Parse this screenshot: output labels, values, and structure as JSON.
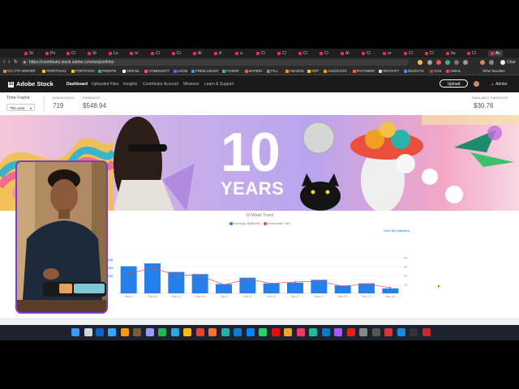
{
  "browser": {
    "tabs": [
      "St",
      "Po",
      "Cl",
      "St",
      "Lo",
      "ni",
      "Cl",
      "Cl",
      "Al",
      "A",
      "a",
      "Cl",
      "Cl",
      "Cl",
      "Cl",
      "Al",
      "Cl",
      "ur",
      "Cl",
      "Cl",
      "bu",
      "Cl",
      "Ac"
    ],
    "url": "https://contributor.stock.adobe.com/ws/portfolio",
    "profile_label": "Chat"
  },
  "bookmarks": [
    {
      "label": "ICC FTP SERVER",
      "color": "#e85"
    },
    {
      "label": "PORTFOLIO",
      "color": "#fc0"
    },
    {
      "label": "PORTFOOO",
      "color": "#fc0"
    },
    {
      "label": "FREEPIK",
      "color": "#4a8"
    },
    {
      "label": "VERCEL",
      "color": "#fff"
    },
    {
      "label": "COMMUNITY",
      "color": "#f55"
    },
    {
      "label": "LOOM",
      "color": "#66f"
    },
    {
      "label": "FREELANCER",
      "color": "#39f"
    },
    {
      "label": "FIVERR",
      "color": "#3c6"
    },
    {
      "label": "MAPBIN",
      "color": "#e55"
    },
    {
      "label": "FILL",
      "color": "#888"
    },
    {
      "label": "AMAZON",
      "color": "#f90"
    },
    {
      "label": "KDP",
      "color": "#fc0"
    },
    {
      "label": "ASSOCIATE",
      "color": "#f90"
    },
    {
      "label": "PAYONEER",
      "color": "#f60"
    },
    {
      "label": "RECRAFT",
      "color": "#ddd"
    },
    {
      "label": "INSIGHTS",
      "color": "#39f"
    },
    {
      "label": "GAS",
      "color": "#c33"
    },
    {
      "label": "GMAIL",
      "color": "#e44"
    }
  ],
  "other_bookmarks": "Other favorites",
  "stock": {
    "logo_badge": "St",
    "logo_text": "Adobe Stock",
    "nav": [
      "Dashboard",
      "Uploaded Files",
      "Insights",
      "Contributor Account",
      "Missions",
      "Learn & Support"
    ],
    "upload_label": "Upload",
    "adobe_label": "Adobe"
  },
  "stats": {
    "time_frame_label": "Time Frame",
    "time_frame_value": "This year",
    "downloads_label": "DOWNLOADS",
    "downloads_value": "719",
    "earnings_label": "EARNINGS",
    "earnings_value": "$548.94",
    "available_label": "AVAILABLE EARNINGS",
    "available_value": "$30.76"
  },
  "banner": {
    "title": "10",
    "subtitle": "YEARS"
  },
  "trend": {
    "title": "12-Week Trend",
    "legend_earnings": "Earnings: $ΜΜ.ΜΜ",
    "legend_downloads": "Downloads: 169",
    "stats_link": "View My Statistics",
    "colors": {
      "earnings": "#2680eb",
      "downloads": "#e34850"
    }
  },
  "chart_data": {
    "type": "bar",
    "title": "12-Week Trend",
    "categories": [
      "Sep 8",
      "Sep 15",
      "Sep 22",
      "Sep 29",
      "Oct 6",
      "Oct 13",
      "Oct 20",
      "Oct 27",
      "Nov 3",
      "Nov 10",
      "Nov 17",
      "Nov 24"
    ],
    "series": [
      {
        "name": "Earnings",
        "type": "bar",
        "values": [
          38,
          42,
          30,
          27,
          13,
          22,
          14,
          15,
          19,
          11,
          14,
          7
        ]
      },
      {
        "name": "Downloads",
        "type": "line",
        "values": [
          28,
          35,
          26,
          25,
          12,
          20,
          14,
          16,
          17,
          10,
          13,
          8
        ]
      }
    ],
    "y_left_ticks": [
      "$$$$$$",
      "$$$$$$",
      "$$$$$$"
    ],
    "y_right_ticks": [
      "40",
      "30",
      "20",
      "10"
    ],
    "ylim": [
      0,
      50
    ]
  },
  "taskbar": {
    "apps": [
      {
        "name": "windows-start",
        "color": "#3a9bf0"
      },
      {
        "name": "search",
        "color": "#cfd6e0"
      },
      {
        "name": "linkedin",
        "color": "#0a66c2"
      },
      {
        "name": "photoshop",
        "color": "#31a8ff"
      },
      {
        "name": "illustrator",
        "color": "#ff9a00"
      },
      {
        "name": "bridge",
        "color": "#7a5a36"
      },
      {
        "name": "premiere",
        "color": "#9999ff"
      },
      {
        "name": "spotify",
        "color": "#1db954"
      },
      {
        "name": "edge",
        "color": "#2ba7e0"
      },
      {
        "name": "chrome",
        "color": "#fbbc05"
      },
      {
        "name": "chrome-2",
        "color": "#ea4335"
      },
      {
        "name": "firefox",
        "color": "#ff7139"
      },
      {
        "name": "app-teal",
        "color": "#20b2aa"
      },
      {
        "name": "edge-2",
        "color": "#0f7bd1"
      },
      {
        "name": "messenger",
        "color": "#0084ff"
      },
      {
        "name": "whatsapp",
        "color": "#25d366"
      },
      {
        "name": "youtube",
        "color": "#ff0000"
      },
      {
        "name": "app-orange",
        "color": "#f5a623"
      },
      {
        "name": "app-pink",
        "color": "#ff3366"
      },
      {
        "name": "app-teal-2",
        "color": "#1abc9c"
      },
      {
        "name": "vscode",
        "color": "#007acc"
      },
      {
        "name": "figma",
        "color": "#a259ff"
      },
      {
        "name": "youtube-2",
        "color": "#e62117"
      },
      {
        "name": "notion",
        "color": "#888888"
      },
      {
        "name": "terminal",
        "color": "#555555"
      },
      {
        "name": "app-red",
        "color": "#d33"
      },
      {
        "name": "app-blue",
        "color": "#1e88e5"
      },
      {
        "name": "app-dark",
        "color": "#333333"
      },
      {
        "name": "recorder",
        "color": "#c62828"
      }
    ]
  }
}
